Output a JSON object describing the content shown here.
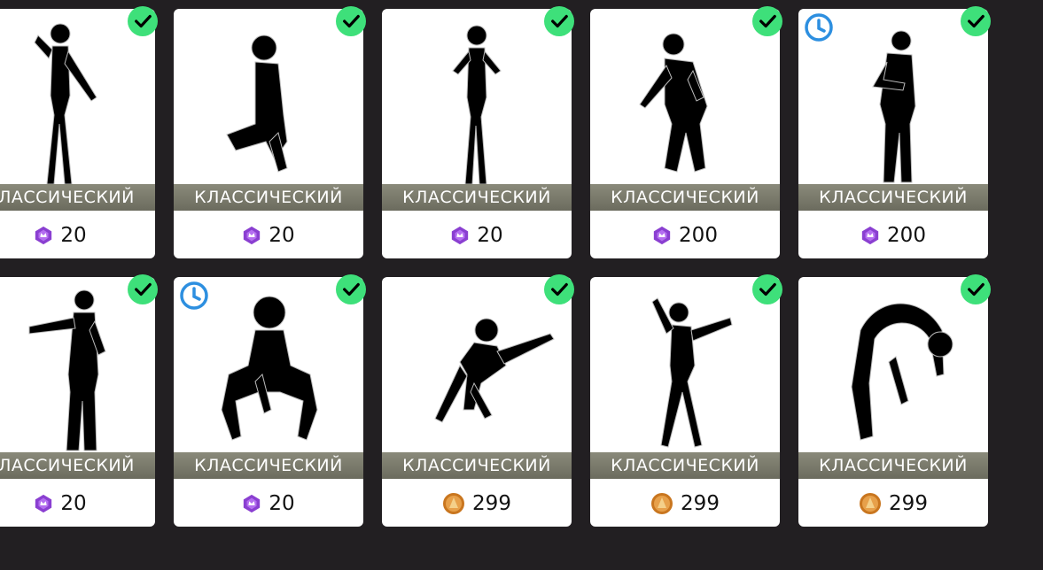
{
  "cards": [
    {
      "label": "КЛАССИЧЕСКИЙ",
      "price": "20",
      "currency": "gem",
      "owned": true,
      "timed": false,
      "pose": "stand-sway"
    },
    {
      "label": "КЛАССИЧЕСКИЙ",
      "price": "20",
      "currency": "gem",
      "owned": true,
      "timed": false,
      "pose": "crouch"
    },
    {
      "label": "КЛАССИЧЕСКИЙ",
      "price": "20",
      "currency": "gem",
      "owned": true,
      "timed": false,
      "pose": "stand-arms"
    },
    {
      "label": "КЛАССИЧЕСКИЙ",
      "price": "200",
      "currency": "gem",
      "owned": true,
      "timed": false,
      "pose": "hiphop-lean"
    },
    {
      "label": "КЛАССИЧЕСКИЙ",
      "price": "200",
      "currency": "gem",
      "owned": true,
      "timed": true,
      "pose": "hiphop-stand"
    },
    {
      "label": "КЛАССИЧЕСКИЙ",
      "price": "20",
      "currency": "gem",
      "owned": true,
      "timed": false,
      "pose": "arm-point"
    },
    {
      "label": "КЛАССИЧЕСКИЙ",
      "price": "20",
      "currency": "gem",
      "owned": true,
      "timed": true,
      "pose": "deep-crouch"
    },
    {
      "label": "КЛАССИЧЕСКИЙ",
      "price": "299",
      "currency": "coin",
      "owned": true,
      "timed": false,
      "pose": "reach"
    },
    {
      "label": "КЛАССИЧЕСКИЙ",
      "price": "299",
      "currency": "coin",
      "owned": true,
      "timed": false,
      "pose": "dance-arm-up"
    },
    {
      "label": "КЛАССИЧЕСКИЙ",
      "price": "299",
      "currency": "coin",
      "owned": true,
      "timed": false,
      "pose": "bend"
    }
  ],
  "colors": {
    "background": "#221f22",
    "check_badge": "#3ee07a",
    "clock_badge": "#2d8fe0",
    "band": "#7a7a6c",
    "gem": "#8a3fd1",
    "coin": "#c9761f"
  },
  "icons": {
    "owned": "checkmark-icon",
    "timed": "clock-icon",
    "gem": "gem-currency-icon",
    "coin": "coin-currency-icon"
  }
}
